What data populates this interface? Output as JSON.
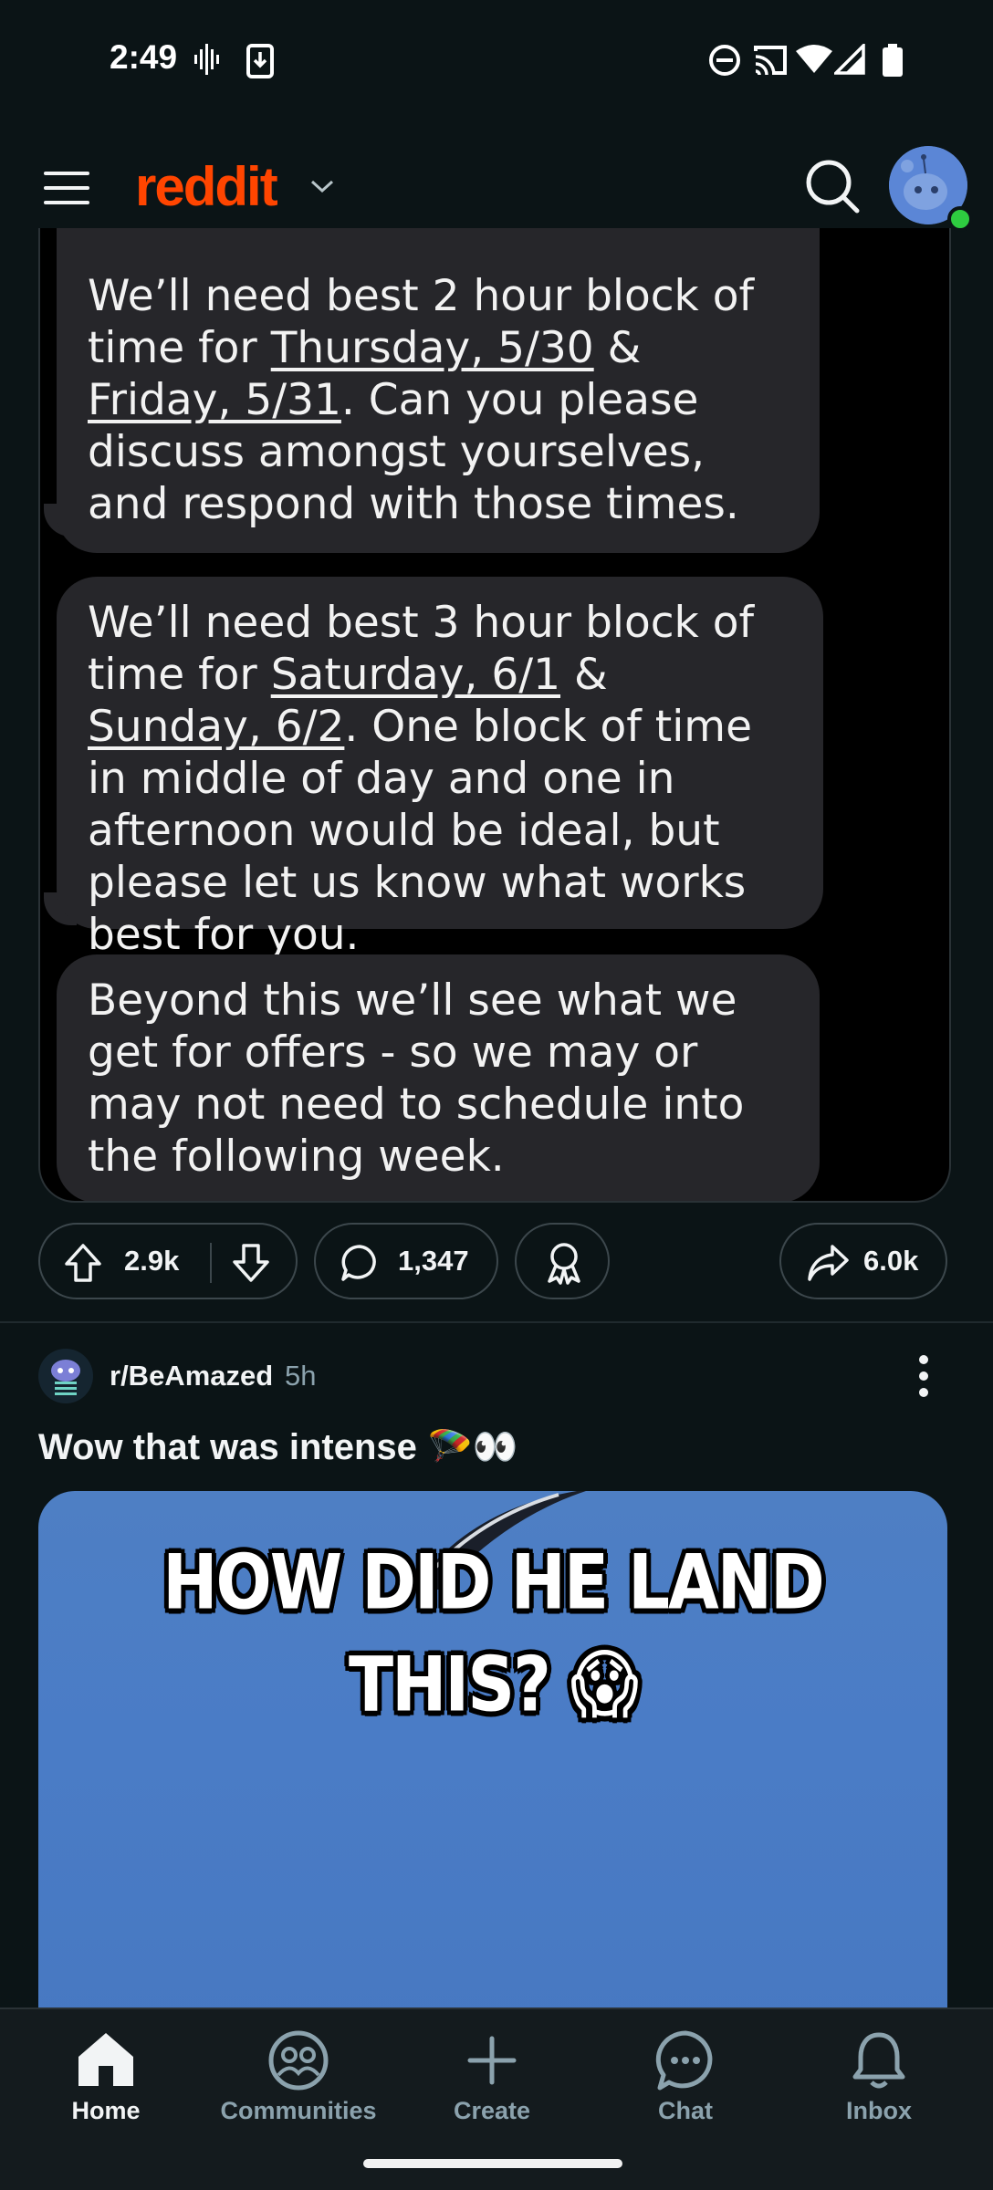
{
  "status_bar": {
    "time": "2:49"
  },
  "header": {
    "logo": "reddit"
  },
  "messages": [
    {
      "parts": [
        {
          "t": "We’ll need best 2 hour block of time for "
        },
        {
          "t": "Thursday, 5/30",
          "u": true
        },
        {
          "t": " & "
        },
        {
          "t": "Friday, 5/31",
          "u": true
        },
        {
          "t": ".  Can you please discuss amongst yourselves, and respond with those times."
        }
      ]
    },
    {
      "parts": [
        {
          "t": "We’ll need best 3 hour block of time for "
        },
        {
          "t": "Saturday, 6/1",
          "u": true
        },
        {
          "t": " & "
        },
        {
          "t": "Sunday, 6/2",
          "u": true
        },
        {
          "t": ".  One block of time in middle of day and one in afternoon would be ideal, but please let us know what works best for you."
        }
      ]
    },
    {
      "parts": [
        {
          "t": "Beyond this we’ll see what we get for offers - so we may or may not need to schedule into the following week."
        }
      ]
    }
  ],
  "post_actions": {
    "upvotes": "2.9k",
    "comments": "1,347",
    "shares": "6.0k"
  },
  "next_post": {
    "subreddit": "r/BeAmazed",
    "age": "5h",
    "title": "Wow that was intense 🪂👀",
    "video_caption_line1": "HOW DID HE LAND",
    "video_caption_line2": "THIS? 😱"
  },
  "bottom_nav": {
    "items": [
      {
        "label": "Home",
        "active": true
      },
      {
        "label": "Communities",
        "active": false
      },
      {
        "label": "Create",
        "active": false
      },
      {
        "label": "Chat",
        "active": false
      },
      {
        "label": "Inbox",
        "active": false
      }
    ]
  },
  "colors": {
    "brand": "#ff4500",
    "background": "#0b1416",
    "bubble": "#26262a",
    "muted": "#8ba2ad"
  }
}
